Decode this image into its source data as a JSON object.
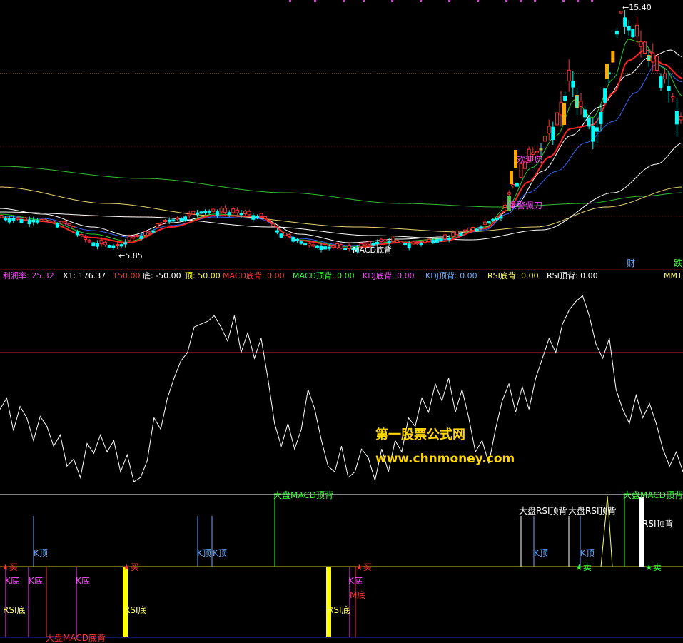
{
  "price_panel": {
    "high_label": "15.40",
    "low_label": "5.85",
    "annotations": [
      "MACD底背",
      "欢迎您",
      "乘警佩刀"
    ],
    "right_labels": [
      "财",
      "跌"
    ]
  },
  "indicator_header": [
    {
      "text": "利润率: 25.32",
      "color": "#ff44ff"
    },
    {
      "text": "X1: 176.37",
      "color": "#ffffff"
    },
    {
      "text": "150.00",
      "color": "#ff3333"
    },
    {
      "text": "底: -50.00",
      "color": "#ffffff"
    },
    {
      "text": "顶: 50.00",
      "color": "#ffff00"
    },
    {
      "text": "MACD底背: 0.00",
      "color": "#ff3333"
    },
    {
      "text": "MACD顶背: 0.00",
      "color": "#33ff33"
    },
    {
      "text": "KDJ底背: 0.00",
      "color": "#ff44ff"
    },
    {
      "text": "KDJ顶背: 0.00",
      "color": "#66aaff"
    },
    {
      "text": "RSI底背: 0.00",
      "color": "#ffff66"
    },
    {
      "text": "RSI顶背: 0.00",
      "color": "#ffffff"
    },
    {
      "text": "MMT",
      "color": "#ffff66"
    }
  ],
  "watermark": {
    "line1": "第一股票公式网",
    "line2": "www.chnmoney.com"
  },
  "signals": {
    "buy": "★买",
    "sell": "★卖",
    "k_top": "K顶",
    "k_bottom": "K底",
    "m_bottom": "M底",
    "rsi_bottom": "RSI底",
    "rsi_top_div": "RSI顶背",
    "market_macd_top": "大盘MACD顶背",
    "market_macd_bottom": "大盘MACD底背",
    "market_rsi_top": "大盘RSI顶背"
  },
  "colors": {
    "up": "#ff3333",
    "down": "#00ffff",
    "ma_red": "#ff2222",
    "ma_green": "#22cc22",
    "ma_white": "#ffffff",
    "ma_blue": "#3366ff",
    "ma_yellow": "#e6d36b",
    "ma_long_green": "#33bb33",
    "upper_line": "#cc2222",
    "lower_line": "#ffffff",
    "signal_base": "#cccc00"
  },
  "chart_data": {
    "type": "line",
    "title": "",
    "price_high": 15.4,
    "price_low": 5.85,
    "indicator_levels": {
      "top": 150.0,
      "bottom": -50.0,
      "top_label": 50.0
    },
    "indicator_value": 176.37,
    "series": [
      {
        "values": [
          110,
          118,
          95,
          112,
          104,
          88,
          105,
          98,
          84,
          92,
          70,
          75,
          62,
          86,
          79,
          92,
          80,
          88,
          66,
          78,
          59,
          62,
          74,
          104,
          96,
          118,
          132,
          144,
          150,
          168,
          170,
          172,
          176,
          168,
          158,
          176,
          150,
          164,
          146,
          160,
          132,
          100,
          84,
          100,
          82,
          96,
          124,
          110,
          88,
          70,
          66,
          84,
          62,
          66,
          82,
          76,
          60,
          82,
          66,
          88,
          80,
          104,
          98,
          118,
          108,
          128,
          116,
          132,
          108,
          124,
          104,
          80,
          88,
          72,
          96,
          116,
          128,
          108,
          126,
          110,
          132,
          146,
          160,
          150,
          170,
          180,
          186,
          190,
          176,
          156,
          146,
          160,
          124,
          110,
          100,
          120,
          104,
          114,
          100,
          82,
          70,
          80,
          66
        ]
      }
    ]
  }
}
